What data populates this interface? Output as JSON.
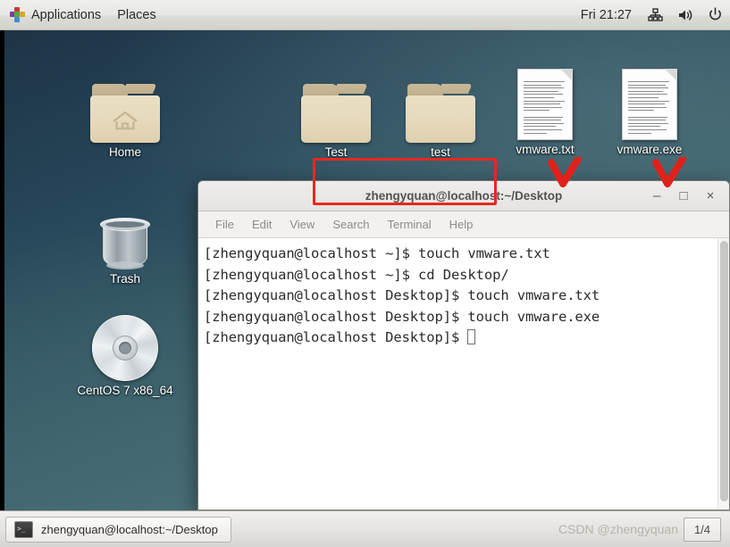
{
  "top_panel": {
    "applications_label": "Applications",
    "places_label": "Places",
    "clock": "Fri 21:27",
    "tray": [
      {
        "name": "network-icon"
      },
      {
        "name": "volume-icon"
      },
      {
        "name": "power-icon"
      }
    ]
  },
  "desktop": {
    "icons": [
      {
        "label": "Home",
        "type": "folder-home"
      },
      {
        "label": "Test",
        "type": "folder"
      },
      {
        "label": "test",
        "type": "folder"
      },
      {
        "label": "vmware.txt",
        "type": "document"
      },
      {
        "label": "vmware.exe",
        "type": "document"
      },
      {
        "label": "Trash",
        "type": "trash"
      },
      {
        "label": "CentOS 7 x86_64",
        "type": "disc"
      }
    ]
  },
  "terminal": {
    "title": "zhengyquan@localhost:~/Desktop",
    "menu": [
      "File",
      "Edit",
      "View",
      "Search",
      "Terminal",
      "Help"
    ],
    "window_buttons": {
      "minimize": "–",
      "maximize": "□",
      "close": "×"
    },
    "lines": [
      "[zhengyquan@localhost ~]$ touch vmware.txt",
      "[zhengyquan@localhost ~]$ cd Desktop/",
      "[zhengyquan@localhost Desktop]$ touch vmware.txt",
      "[zhengyquan@localhost Desktop]$ touch vmware.exe",
      "[zhengyquan@localhost Desktop]$ "
    ]
  },
  "annotations": {
    "highlight_color": "#e8281e",
    "checkmarks": [
      "vmware.txt",
      "vmware.exe"
    ],
    "boxed_commands": [
      "touch vmware.txt",
      "touch vmware.exe"
    ]
  },
  "taskbar": {
    "window_button_label": "zhengyquan@localhost:~/Desktop",
    "watermark": "CSDN @zhengyquan",
    "workspace": "1/4"
  }
}
